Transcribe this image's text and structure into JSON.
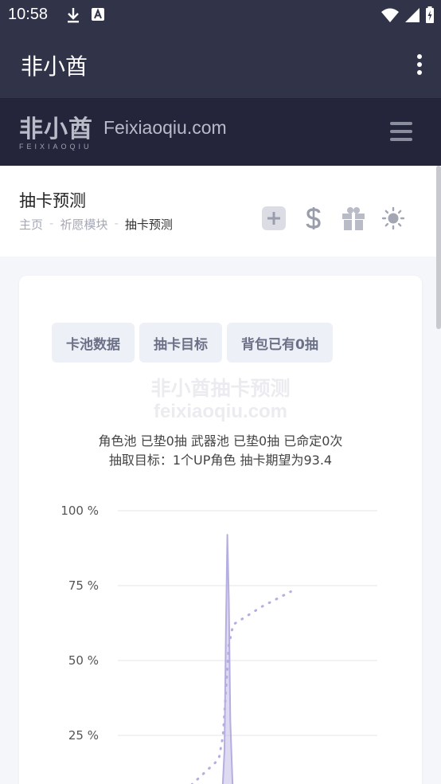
{
  "status_bar": {
    "time": "10:58"
  },
  "app_bar": {
    "title": "非小酋"
  },
  "site_header": {
    "logo_cn": "非小酋",
    "logo_en": "FEIXIAOQIU",
    "domain": "Feixiaoqiu.com"
  },
  "page": {
    "title": "抽卡预测",
    "breadcrumb": [
      "主页",
      "祈愿模块",
      "抽卡预测"
    ],
    "breadcrumb_sep": "-"
  },
  "tabs": [
    "卡池数据",
    "抽卡目标",
    "背包已有0抽"
  ],
  "watermark": {
    "line1": "非小酋抽卡预测",
    "line2": "feixiaoqiu.com"
  },
  "summary": {
    "line1": "角色池 已垫0抽 武器池 已垫0抽 已命定0次",
    "line2": "抽取目标：1个UP角色 抽卡期望为93.4"
  },
  "colors": {
    "header_bg": "#313449",
    "site_bg": "#24243a",
    "accent": "#b5aee0"
  },
  "chart_data": {
    "type": "line",
    "y_ticks": [
      "100 %",
      "75 %",
      "50 %",
      "25 %"
    ],
    "ylim": [
      0,
      100
    ],
    "xlim": [
      0,
      180
    ],
    "series": [
      {
        "kind": "density_area",
        "x": [
          70,
          72,
          74,
          75,
          76,
          77,
          78,
          80,
          82
        ],
        "y": [
          0,
          1,
          20,
          60,
          92,
          70,
          30,
          3,
          0
        ]
      },
      {
        "kind": "cumulative_dotted",
        "x": [
          30,
          50,
          70,
          73,
          75,
          77,
          80,
          100,
          120
        ],
        "y": [
          0,
          8,
          17,
          25,
          40,
          55,
          62,
          68,
          73
        ]
      }
    ]
  }
}
